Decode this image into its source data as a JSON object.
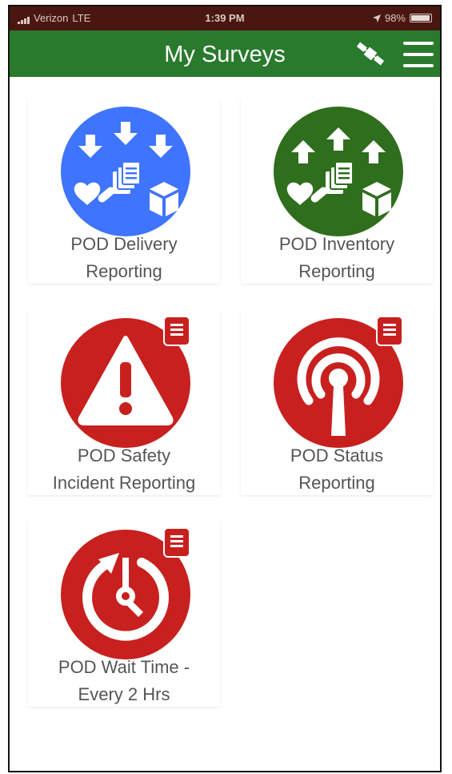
{
  "status_bar": {
    "carrier": "Verizon",
    "network": "LTE",
    "time": "1:39 PM",
    "battery": "98%"
  },
  "header": {
    "title": "My Surveys",
    "satellite_icon": "satellite-icon",
    "menu_icon": "hamburger-menu-icon",
    "color": "#2a7a2e"
  },
  "surveys": [
    {
      "line1": "POD Delivery",
      "line2": "Reporting",
      "icon": "delivery-icon",
      "color": "#3f74ff",
      "has_badge": false
    },
    {
      "line1": "POD Inventory",
      "line2": "Reporting",
      "icon": "inventory-icon",
      "color": "#2e6e1d",
      "has_badge": false
    },
    {
      "line1": "POD Safety",
      "line2": "Incident Reporting",
      "icon": "warning-icon",
      "color": "#c8201f",
      "has_badge": true
    },
    {
      "line1": "POD Status",
      "line2": "Reporting",
      "icon": "broadcast-icon",
      "color": "#c8201f",
      "has_badge": true
    },
    {
      "line1": "POD Wait Time -",
      "line2": "Every 2 Hrs",
      "icon": "timer-icon",
      "color": "#c8201f",
      "has_badge": true
    }
  ]
}
